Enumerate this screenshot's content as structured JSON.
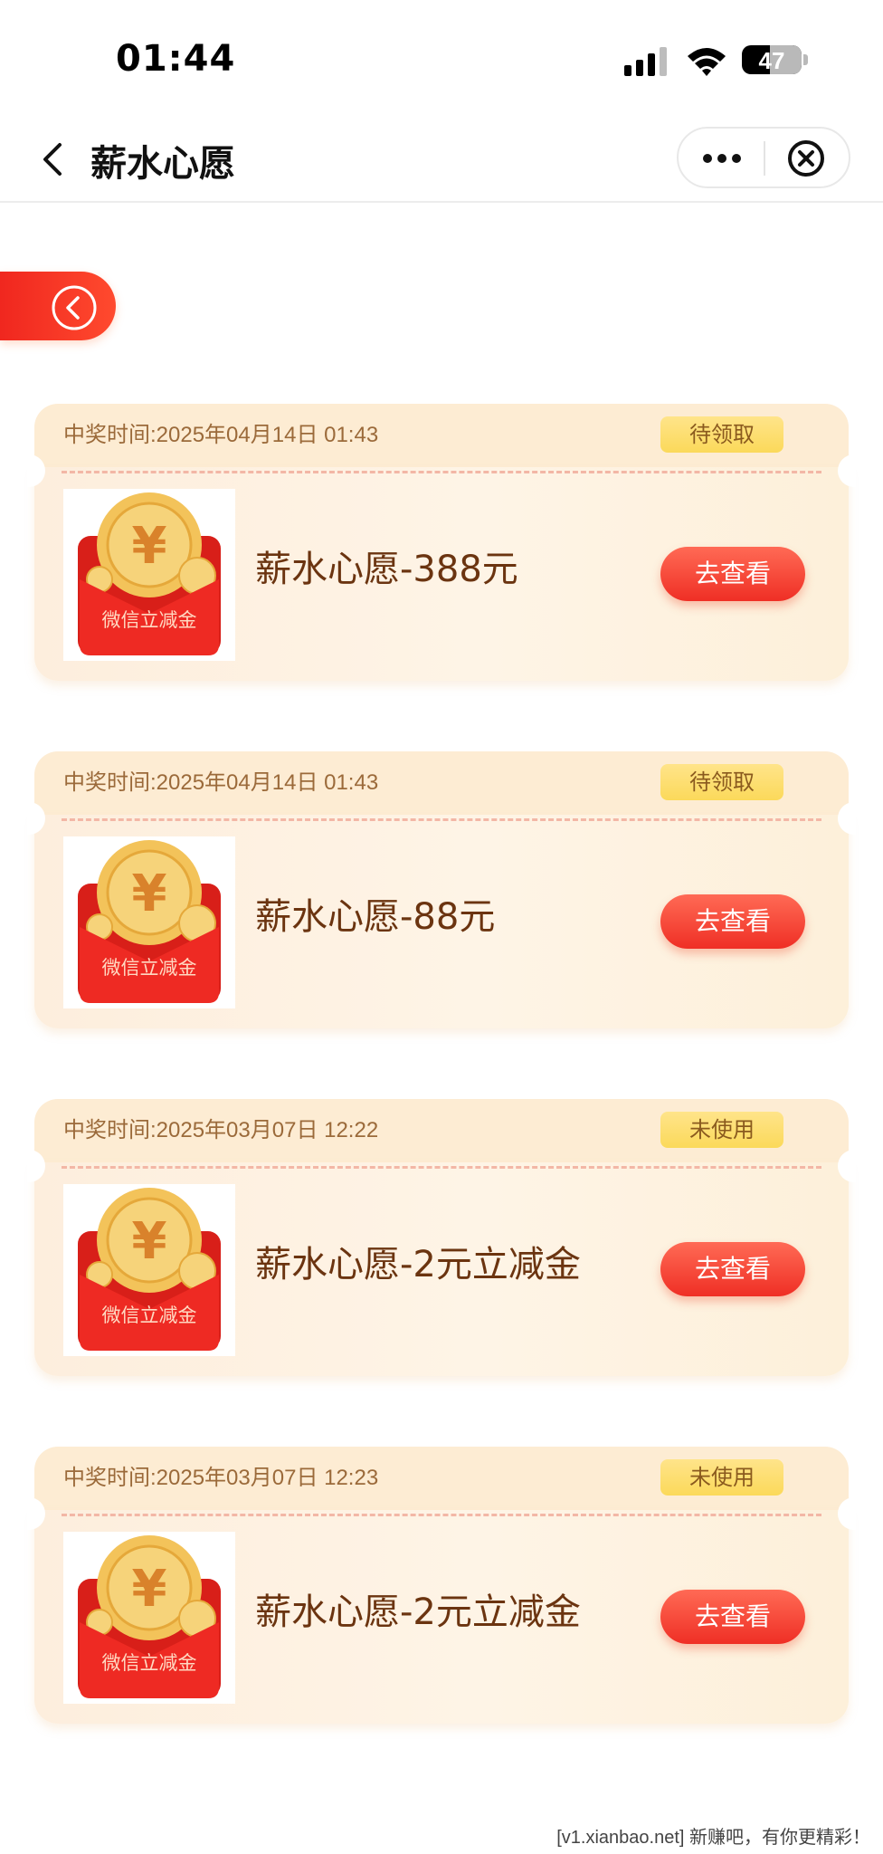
{
  "status_bar": {
    "time": "01:44",
    "battery": "47",
    "battery_level": 0.47
  },
  "nav": {
    "title": "薪水心愿"
  },
  "records": [
    {
      "time_label": "中奖时间:2025年04月14日 01:43",
      "status": "待领取",
      "name": "薪水心愿-388元",
      "thumb_text": "微信立减金",
      "action": "去查看"
    },
    {
      "time_label": "中奖时间:2025年04月14日 01:43",
      "status": "待领取",
      "name": "薪水心愿-88元",
      "thumb_text": "微信立减金",
      "action": "去查看"
    },
    {
      "time_label": "中奖时间:2025年03月07日 12:22",
      "status": "未使用",
      "name": "薪水心愿-2元立减金",
      "thumb_text": "微信立减金",
      "action": "去查看"
    },
    {
      "time_label": "中奖时间:2025年03月07日 12:23",
      "status": "未使用",
      "name": "薪水心愿-2元立减金",
      "thumb_text": "微信立减金",
      "action": "去查看"
    }
  ],
  "watermark": "[v1.xianbao.net] 新赚吧，有你更精彩！",
  "colors": {
    "accent_red": "#ef2f25",
    "badge_yellow": "#fbd95a",
    "card_bg": "#fdeedd",
    "title_brown": "#6b3410"
  }
}
